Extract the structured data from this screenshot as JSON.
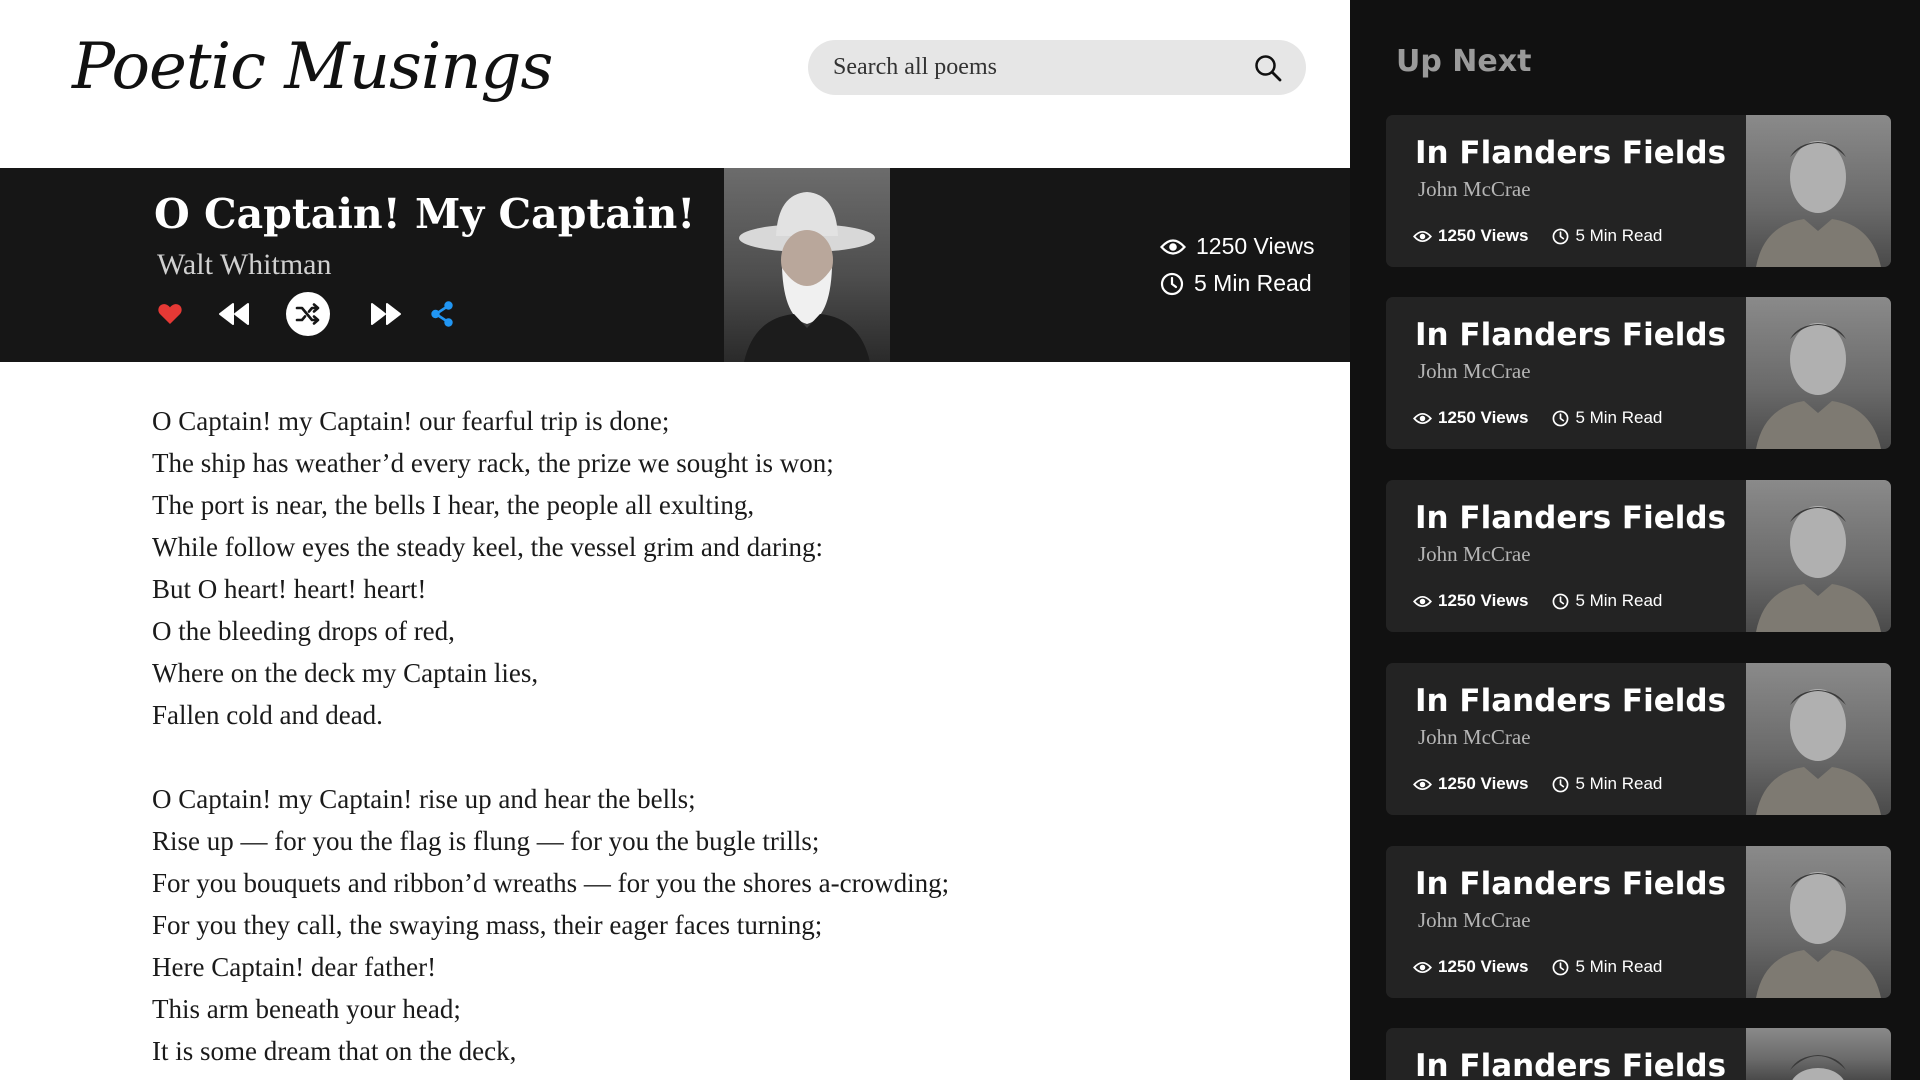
{
  "app": {
    "logo": "Poetic Musings"
  },
  "search": {
    "placeholder": "Search all poems",
    "icon": "search-icon"
  },
  "now_playing": {
    "title": "O Captain! My Captain!",
    "author": "Walt Whitman",
    "views": "1250 Views",
    "read_time": "5 Min Read",
    "controls": [
      "heart-icon",
      "rewind-icon",
      "shuffle-icon",
      "fast-forward-icon",
      "share-icon"
    ],
    "colors": {
      "heart": "#e53935",
      "share": "#2196f3",
      "banner": "#161616"
    }
  },
  "poem": {
    "stanzas": [
      [
        "O Captain! my Captain! our fearful trip is done;",
        "The ship has weather’d every rack, the prize we sought is won;",
        "The port is near, the bells I hear, the people all exulting,",
        "While follow eyes the steady keel, the vessel grim and daring:",
        "But O heart! heart! heart!",
        "O the bleeding drops of red,",
        "Where on the deck my Captain lies,",
        "Fallen cold and dead."
      ],
      [
        "O Captain! my Captain! rise up and hear the bells;",
        "Rise up — for you the flag is flung — for you the bugle trills;",
        "For you bouquets and ribbon’d wreaths — for you the shores a-crowding;",
        "For you they call, the swaying mass, their eager faces turning;",
        "Here Captain! dear father!",
        "This arm beneath your head;",
        "It is some dream that on the deck,"
      ]
    ]
  },
  "sidebar": {
    "title": "Up Next",
    "items": [
      {
        "title": "In Flanders Fields",
        "author": "John McCrae",
        "views": "1250 Views",
        "read_time": "5 Min Read"
      },
      {
        "title": "In Flanders Fields",
        "author": "John McCrae",
        "views": "1250 Views",
        "read_time": "5 Min Read"
      },
      {
        "title": "In Flanders Fields",
        "author": "John McCrae",
        "views": "1250 Views",
        "read_time": "5 Min Read"
      },
      {
        "title": "In Flanders Fields",
        "author": "John McCrae",
        "views": "1250 Views",
        "read_time": "5 Min Read"
      },
      {
        "title": "In Flanders Fields",
        "author": "John McCrae",
        "views": "1250 Views",
        "read_time": "5 Min Read"
      },
      {
        "title": "In Flanders Fields",
        "author": "",
        "views": "",
        "read_time": ""
      }
    ]
  }
}
